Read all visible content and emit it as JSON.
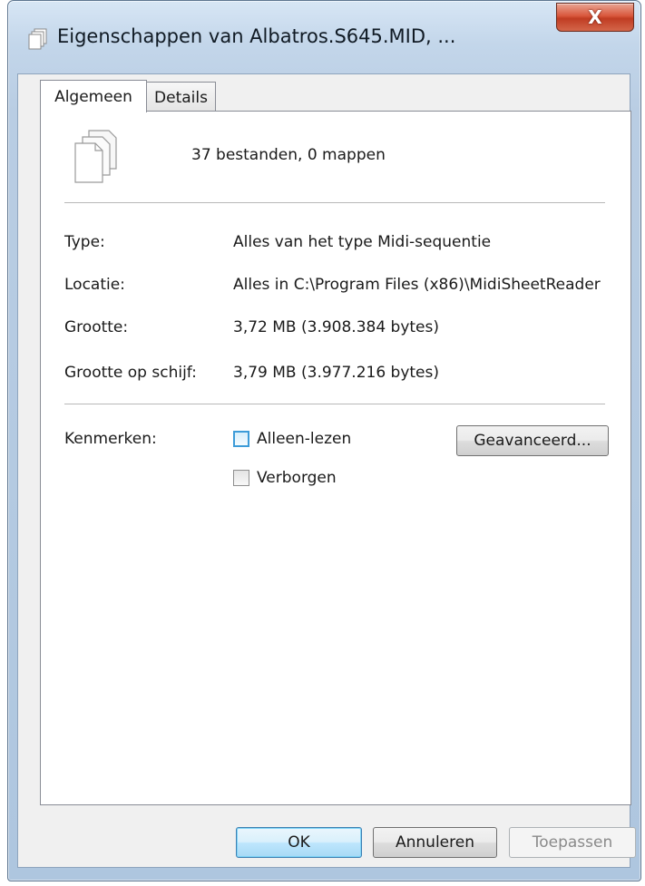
{
  "window": {
    "title": "Eigenschappen van Albatros.S645.MID, ...",
    "close_label": "X"
  },
  "tabs": [
    {
      "label": "Algemeen",
      "active": true
    },
    {
      "label": "Details",
      "active": false
    }
  ],
  "general": {
    "summary": "37 bestanden, 0 mappen",
    "rows": [
      {
        "label": "Type:",
        "value": "Alles van het type Midi-sequentie"
      },
      {
        "label": "Locatie:",
        "value": "Alles in C:\\Program Files (x86)\\MidiSheetReader"
      },
      {
        "label": "Grootte:",
        "value": "3,72 MB (3.908.384 bytes)"
      },
      {
        "label": "Grootte op schijf:",
        "value": "3,79 MB (3.977.216 bytes)"
      }
    ],
    "attributes_label": "Kenmerken:",
    "attributes": [
      {
        "label": "Alleen-lezen",
        "checked": false
      },
      {
        "label": "Verborgen",
        "checked": false
      }
    ],
    "advanced_button": "Geavanceerd..."
  },
  "buttons": {
    "ok": "OK",
    "cancel": "Annuleren",
    "apply": "Toepassen"
  },
  "icons": {
    "title": "files-icon",
    "close": "close-icon",
    "summary": "multiple-files-icon"
  },
  "colors": {
    "titlebar": "#c3d6ea",
    "close_button": "#d9573c",
    "focus_blue": "#3c9bd8"
  }
}
